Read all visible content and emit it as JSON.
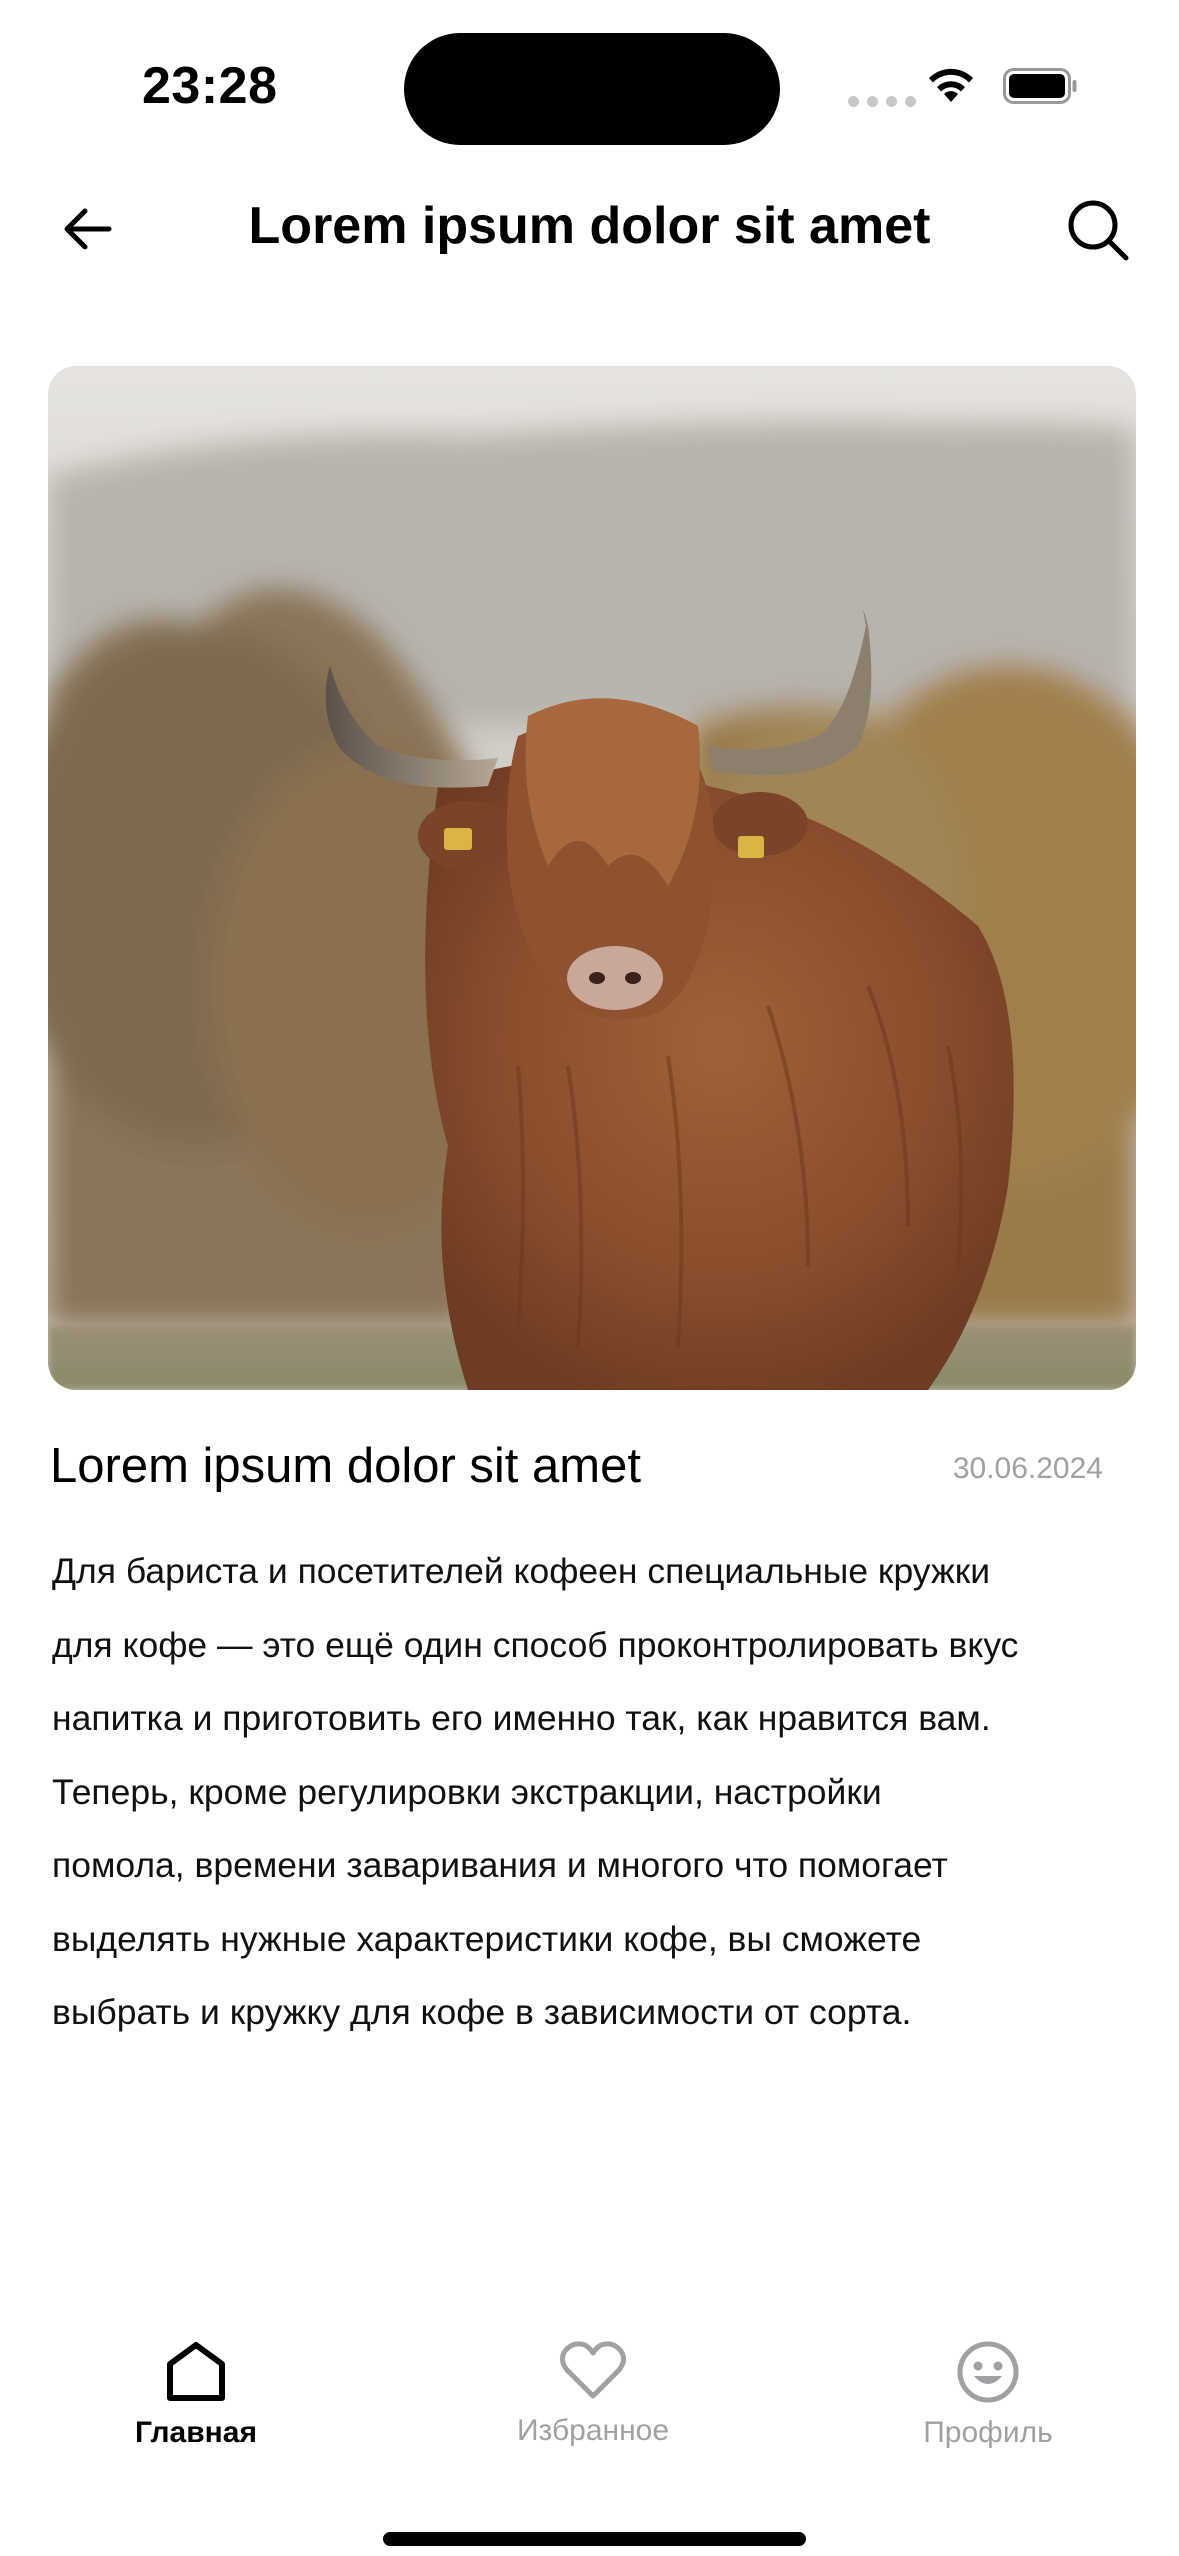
{
  "status_bar": {
    "time": "23:28"
  },
  "header": {
    "title": "Lorem ipsum dolor sit amet"
  },
  "article": {
    "title": "Lorem ipsum dolor sit amet",
    "date": "30.06.2024",
    "body_lines": [
      "Для бариста и посетителей кофеен специальные кружки",
      "для кофе — это ещё один способ проконтролировать вкус",
      "напитка и приготовить его именно так, как нравится вам.",
      "Теперь, кроме регулировки экстракции, настройки",
      "помола, времени заваривания и многого что помогает",
      "выделять нужные характеристики кофе, вы сможете",
      "выбрать и кружку для кофе в зависимости от сорта."
    ]
  },
  "tab_bar": {
    "tabs": [
      {
        "label": "Главная",
        "icon": "home-icon",
        "active": true
      },
      {
        "label": "Избранное",
        "icon": "heart-icon",
        "active": false
      },
      {
        "label": "Профиль",
        "icon": "smiley-icon",
        "active": false
      }
    ]
  },
  "colors": {
    "inactive": "#a0a0a5",
    "active": "#000000"
  }
}
